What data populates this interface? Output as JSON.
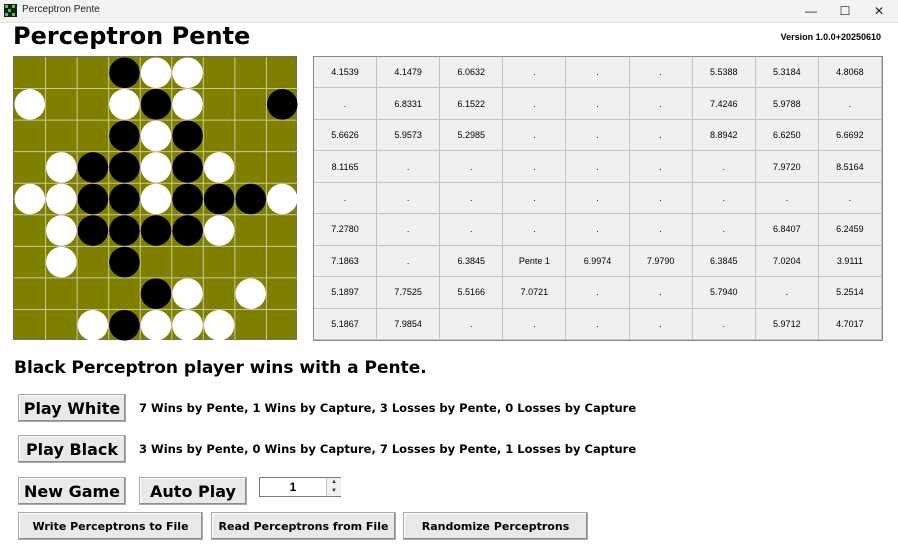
{
  "window": {
    "title": "Perceptron Pente",
    "minimize_glyph": "—",
    "maximize_glyph": "☐",
    "close_glyph": "✕"
  },
  "app": {
    "title": "Perceptron Pente",
    "version": "Version 1.0.0+20250610"
  },
  "board": {
    "size": 9,
    "colors": {
      "background": "#808000",
      "grid": "#c8c8a0",
      "black": "#000000",
      "white": "#ffffff"
    },
    "rows": [
      ".  .  .  B  W  W  .  .  .",
      "W  .  .  W  B  W  .  .  B",
      ".  .  .  B  W  B  .  .  .",
      ".  W  B  B  W  B  W  .  .",
      "W  W  B  B  W  B  B  B  W",
      ".  W  B  B  B  B  W  .  .",
      ".  W  .  B  .  .  .  .  .",
      ".  .  .  .  B  W  .  W  .",
      ".  .  W  B  W  W  W  .  ."
    ]
  },
  "weights_table": [
    [
      "4.1539",
      "4.1479",
      "6.0632",
      ".",
      ".",
      ".",
      "5.5388",
      "5.3184",
      "4.8068"
    ],
    [
      ".",
      "6.8331",
      "6.1522",
      ".",
      ".",
      ".",
      "7.4246",
      "5.9788",
      "."
    ],
    [
      "5.6626",
      "5.9573",
      "5.2985",
      ".",
      ".",
      ".",
      "8.8942",
      "6.6250",
      "6.6692"
    ],
    [
      "8.1165",
      ".",
      ".",
      ".",
      ".",
      ".",
      ".",
      "7.9720",
      "8.5164"
    ],
    [
      ".",
      ".",
      ".",
      ".",
      ".",
      ".",
      ".",
      ".",
      "."
    ],
    [
      "7.2780",
      ".",
      ".",
      ".",
      ".",
      ".",
      ".",
      "6.8407",
      "6.2459"
    ],
    [
      "7.1863",
      ".",
      "6.3845",
      "Pente 1",
      "6.9974",
      "7.9790",
      "6.3845",
      "7.0204",
      "3.9111"
    ],
    [
      "5.1897",
      "7.7525",
      "5.5166",
      "7.0721",
      ".",
      ".",
      "5.7940",
      ".",
      "5.2514"
    ],
    [
      "5.1867",
      "7.9854",
      ".",
      ".",
      ".",
      ".",
      ".",
      "5.9712",
      "4.7017"
    ]
  ],
  "status": "Black Perceptron player wins with a Pente.",
  "buttons": {
    "play_white": "Play White",
    "play_black": "Play Black",
    "new_game": "New Game",
    "auto_play": "Auto Play",
    "write": "Write Perceptrons to File",
    "read": "Read Perceptrons from File",
    "randomize": "Randomize Perceptrons"
  },
  "stats": {
    "white": "7 Wins by Pente, 1 Wins by Capture, 3 Losses by Pente, 0 Losses by Capture",
    "black": "3 Wins by Pente, 0 Wins by Capture, 7 Losses by Pente, 1 Losses by Capture"
  },
  "auto_play_count": "1"
}
